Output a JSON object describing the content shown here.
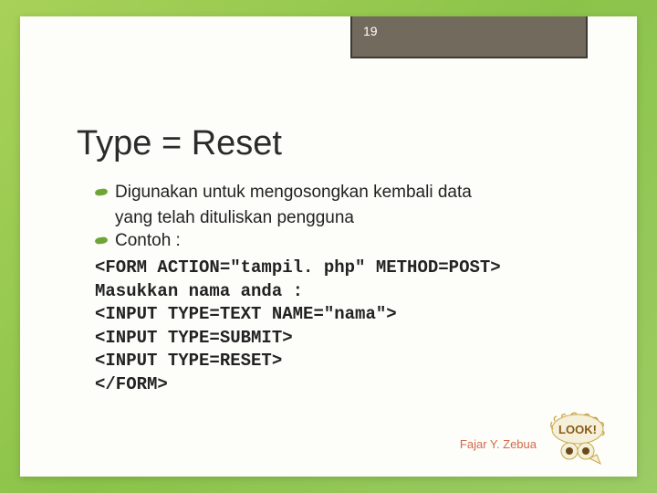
{
  "page_number": "19",
  "title": "Type = Reset",
  "bullets": {
    "b1": "Digunakan untuk mengosongkan kembali data",
    "b1_cont": "yang telah dituliskan pengguna",
    "b2": "Contoh :"
  },
  "code": {
    "l1": "<FORM ACTION=\"tampil. php\" METHOD=POST>",
    "l2": "Masukkan nama anda :",
    "l3": "<INPUT TYPE=TEXT NAME=\"nama\">",
    "l4": "<INPUT TYPE=SUBMIT>",
    "l5": "<INPUT TYPE=RESET>",
    "l6": "</FORM>"
  },
  "footer": "Fajar Y. Zebua",
  "look_label": "LOOK!"
}
